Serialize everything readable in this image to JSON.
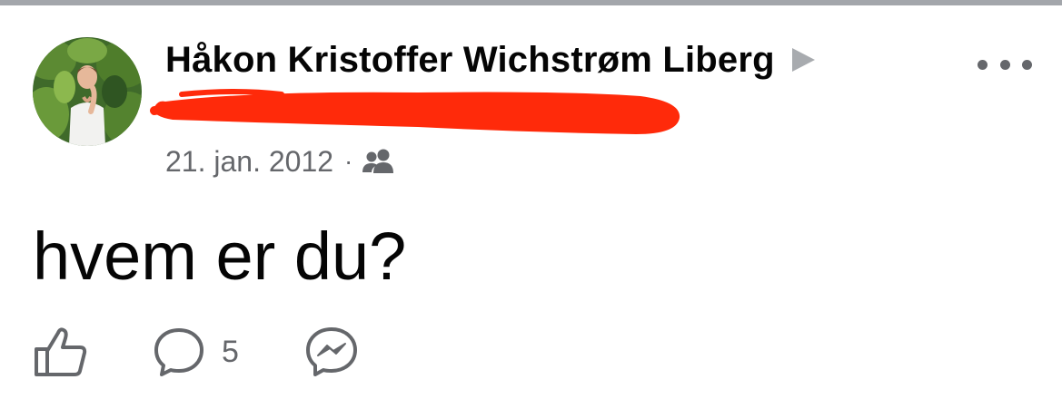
{
  "post": {
    "author_name": "Håkon Kristoffer Wichstrøm Liberg",
    "date": "21. jan. 2012",
    "separator": "·",
    "audience_icon": "friends-icon",
    "text": "hvem er du?",
    "comment_count": "5"
  },
  "icons": {
    "arrow": "play-arrow-icon",
    "more": "more-dots-icon",
    "like": "thumbs-up-icon",
    "comment": "comment-bubble-icon",
    "share": "messenger-icon"
  },
  "colors": {
    "text_primary": "#050505",
    "text_secondary": "#65676b",
    "redaction": "#ff2a0a",
    "top_bar": "#a3a6ab"
  }
}
